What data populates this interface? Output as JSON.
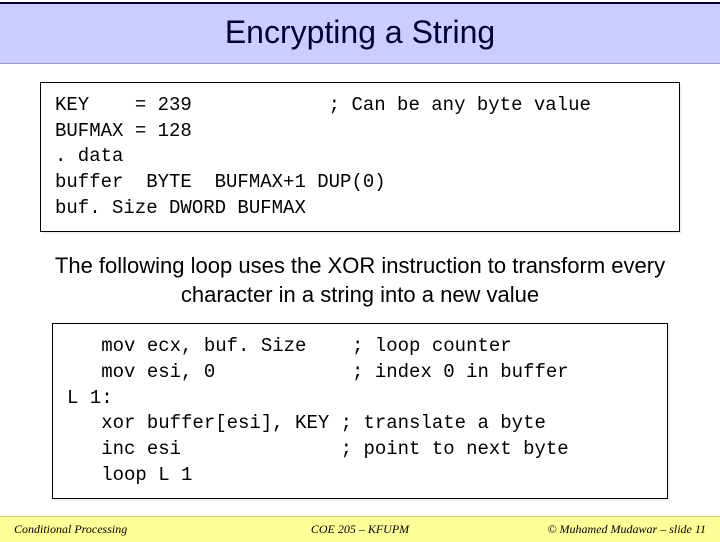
{
  "title": "Encrypting a String",
  "code1": "KEY    = 239            ; Can be any byte value\nBUFMAX = 128\n. data\nbuffer  BYTE  BUFMAX+1 DUP(0)\nbuf. Size DWORD BUFMAX",
  "body": "The following loop uses the XOR instruction to transform every character in a string into a new value",
  "code2": "   mov ecx, buf. Size    ; loop counter\n   mov esi, 0            ; index 0 in buffer\nL 1:\n   xor buffer[esi], KEY ; translate a byte\n   inc esi              ; point to next byte\n   loop L 1",
  "footer": {
    "left": "Conditional Processing",
    "center": "COE 205 – KFUPM",
    "right": "© Muhamed Mudawar – slide 11"
  }
}
